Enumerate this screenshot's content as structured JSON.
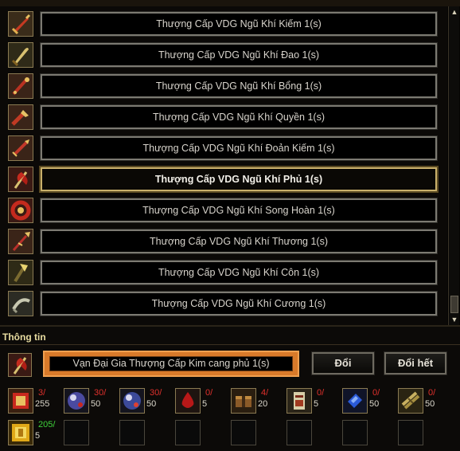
{
  "header": {
    "left_text": "",
    "right_text": ""
  },
  "items": [
    {
      "label": "Thượng Cấp VDG Ngũ Khí Kiếm 1(s)",
      "icon": "sword-icon",
      "selected": false
    },
    {
      "label": "Thượng Cấp VDG Ngũ Khí Đao 1(s)",
      "icon": "blade-icon",
      "selected": false
    },
    {
      "label": "Thượng Cấp VDG Ngũ Khí Bổng 1(s)",
      "icon": "staff-icon",
      "selected": false
    },
    {
      "label": "Thượng Cấp VDG Ngũ Khí Quyền 1(s)",
      "icon": "fist-icon",
      "selected": false
    },
    {
      "label": "Thượng Cấp VDG Ngũ Khí Đoản Kiếm 1(s)",
      "icon": "dagger-icon",
      "selected": false
    },
    {
      "label": "Thượng Cấp VDG Ngũ Khí Phủ 1(s)",
      "icon": "axe-icon",
      "selected": true
    },
    {
      "label": "Thượng Cấp VDG Ngũ Khí Song Hoàn 1(s)",
      "icon": "ring-icon",
      "selected": false
    },
    {
      "label": "Thượng Cấp VDG Ngũ Khí Thương 1(s)",
      "icon": "spear-icon",
      "selected": false
    },
    {
      "label": "Thượng Cấp VDG Ngũ Khí Côn 1(s)",
      "icon": "club-icon",
      "selected": false
    },
    {
      "label": "Thượng Cấp VDG Ngũ Khí Cương 1(s)",
      "icon": "cane-icon",
      "selected": false
    }
  ],
  "info": {
    "title": "Thông tin",
    "selected_name": "Vạn Đại Gia Thượng Cấp Kim cang phủ 1(s)",
    "exchange_label": "Đổi",
    "exchange_all_label": "Đổi hết"
  },
  "materials": [
    {
      "icon": "red-token-icon",
      "have": "3/",
      "need": "255"
    },
    {
      "icon": "red-orb-icon",
      "have": "30/",
      "need": "50"
    },
    {
      "icon": "blue-orb-icon",
      "have": "30/",
      "need": "50"
    },
    {
      "icon": "blood-drop-icon",
      "have": "0/",
      "need": "5"
    },
    {
      "icon": "box-icon",
      "have": "4/",
      "need": "20"
    },
    {
      "icon": "scroll-icon",
      "have": "0/",
      "need": "5"
    },
    {
      "icon": "blue-gem-icon",
      "have": "0/",
      "need": "50"
    },
    {
      "icon": "bundle-icon",
      "have": "0/",
      "need": "50"
    },
    {
      "icon": "gold-token-icon",
      "have": "205/",
      "need": "5"
    }
  ],
  "colors": {
    "insufficient": "#e0302c",
    "sufficient": "#3ed23a",
    "selected_border": "#c9b06b",
    "name_frame": "#d97a2a"
  }
}
